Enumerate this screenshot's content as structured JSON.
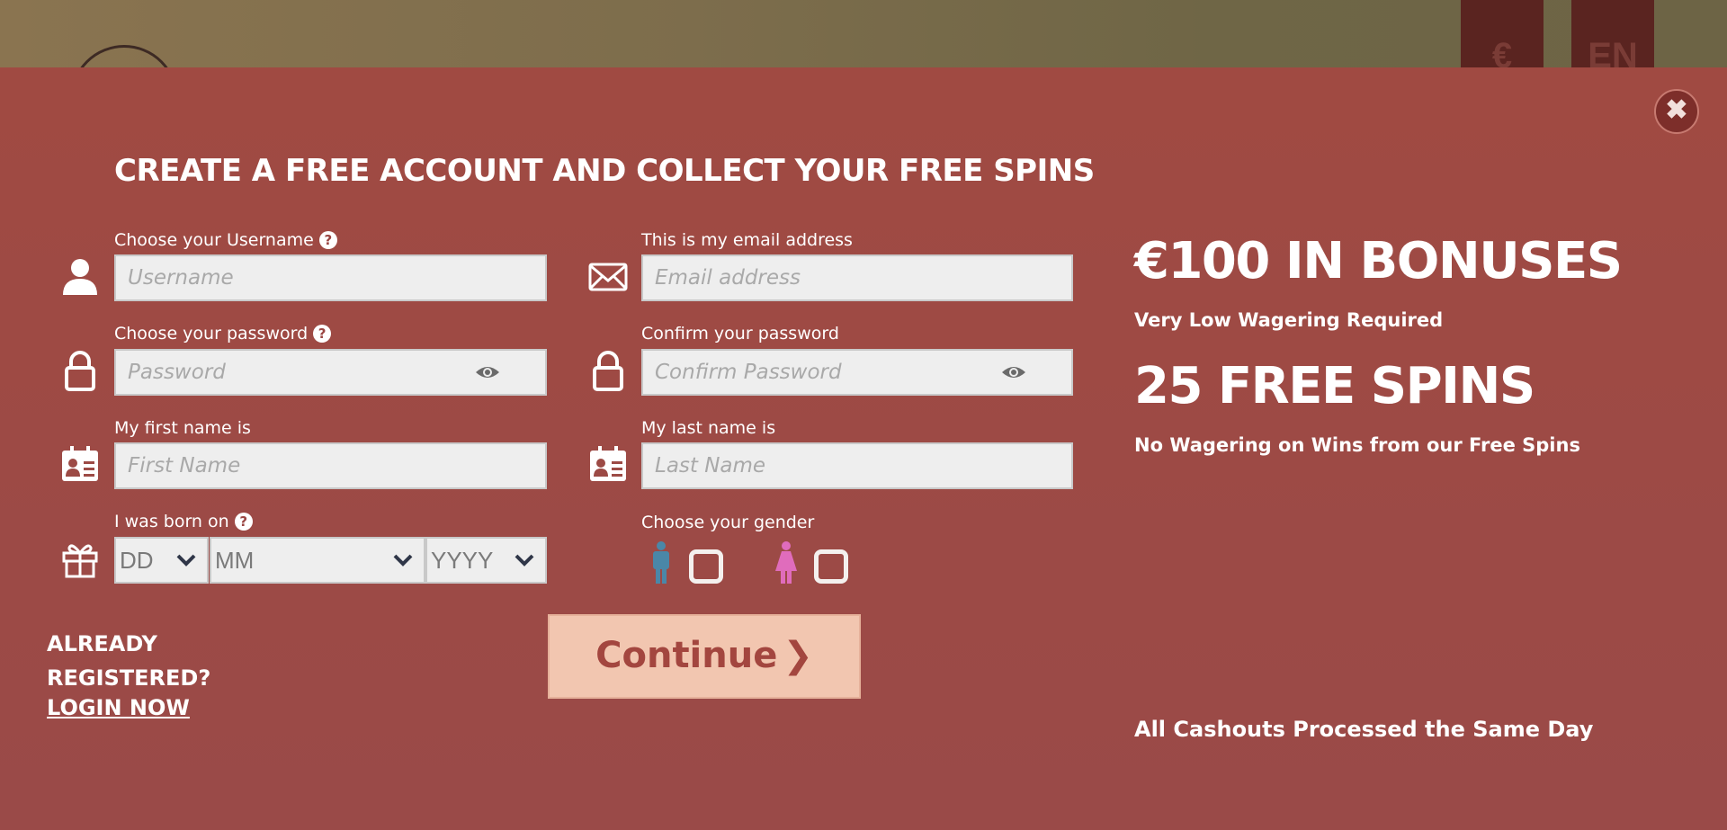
{
  "background": {
    "currency_tab": "€",
    "language_tab": "EN"
  },
  "modal": {
    "close_label": "✖",
    "title": "CREATE A FREE ACCOUNT AND COLLECT YOUR FREE SPINS",
    "username": {
      "label": "Choose your Username",
      "placeholder": "Username",
      "help": "?"
    },
    "email": {
      "label": "This is my email address",
      "placeholder": "Email address"
    },
    "password": {
      "label": "Choose your password",
      "placeholder": "Password",
      "help": "?"
    },
    "confirm_password": {
      "label": "Confirm your password",
      "placeholder": "Confirm Password"
    },
    "first_name": {
      "label": "My first name is",
      "placeholder": "First Name"
    },
    "last_name": {
      "label": "My last name is",
      "placeholder": "Last Name"
    },
    "birth": {
      "label": "I was born on",
      "help": "?",
      "day": "DD",
      "month": "MM",
      "year": "YYYY"
    },
    "gender": {
      "label": "Choose your gender",
      "male_icon": "male-icon",
      "female_icon": "female-icon"
    },
    "already_registered_line1": "ALREADY",
    "already_registered_line2": "REGISTERED?",
    "login_link": "LOGIN NOW",
    "continue_label": "Continue",
    "continue_arrow": "❯"
  },
  "promo": {
    "bonus_headline": "€100 IN BONUSES",
    "bonus_sub": "Very Low Wagering Required",
    "spins_headline": "25 FREE SPINS",
    "spins_sub": "No Wagering on Wins from our Free Spins",
    "cashout": "All Cashouts Processed the Same Day"
  },
  "colors": {
    "modal_bg": "#a04a42",
    "continue_bg": "#f2c6b0",
    "continue_text": "#a3463f",
    "male": "#4a87a8",
    "female": "#e06cbc"
  }
}
